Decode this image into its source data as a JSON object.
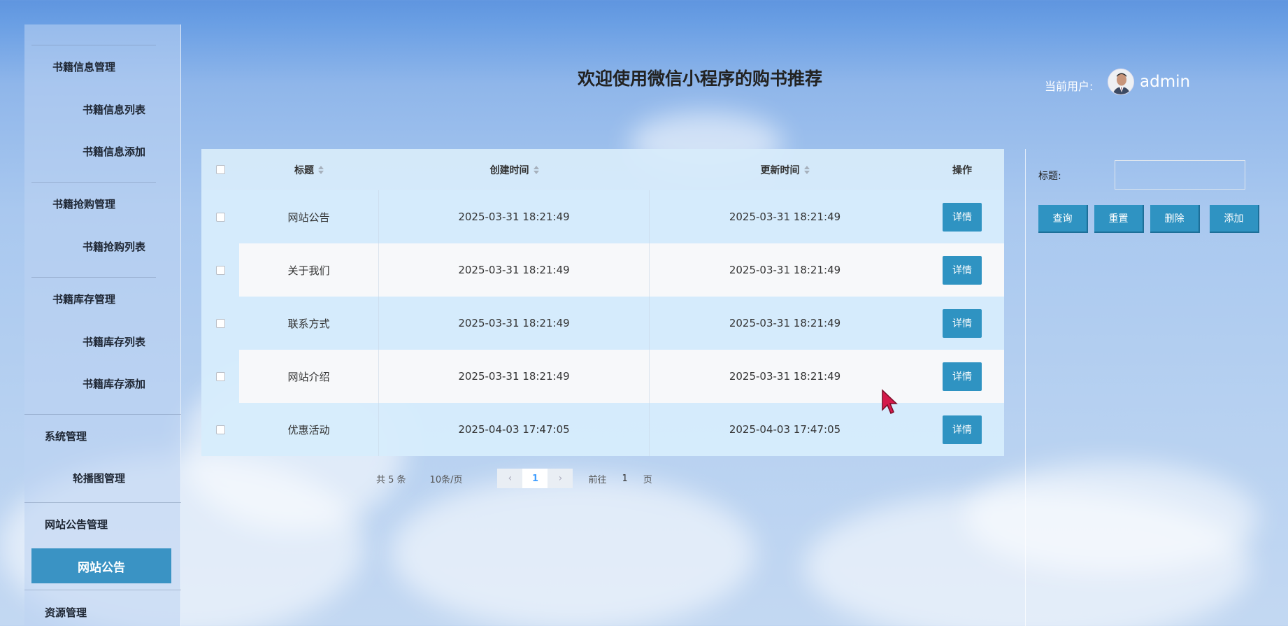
{
  "sidebar": {
    "items": [
      {
        "label": "书籍信息管理"
      },
      {
        "label": "书籍信息列表"
      },
      {
        "label": "书籍信息添加"
      },
      {
        "label": "书籍抢购管理"
      },
      {
        "label": "书籍抢购列表"
      },
      {
        "label": "书籍库存管理"
      },
      {
        "label": "书籍库存列表"
      },
      {
        "label": "书籍库存添加"
      },
      {
        "label": "系统管理"
      },
      {
        "label": "轮播图管理"
      },
      {
        "label": "网站公告管理"
      },
      {
        "label": "网站公告"
      },
      {
        "label": "资源管理"
      }
    ]
  },
  "header": {
    "title": "欢迎使用微信小程序的购书推荐",
    "user_label": "当前用户:",
    "username": "admin"
  },
  "table": {
    "columns": {
      "title": "标题",
      "created": "创建时间",
      "updated": "更新时间",
      "ops": "操作"
    },
    "rows": [
      {
        "title": "网站公告",
        "created": "2025-03-31 18:21:49",
        "updated": "2025-03-31 18:21:49",
        "action": "详情"
      },
      {
        "title": "关于我们",
        "created": "2025-03-31 18:21:49",
        "updated": "2025-03-31 18:21:49",
        "action": "详情"
      },
      {
        "title": "联系方式",
        "created": "2025-03-31 18:21:49",
        "updated": "2025-03-31 18:21:49",
        "action": "详情"
      },
      {
        "title": "网站介绍",
        "created": "2025-03-31 18:21:49",
        "updated": "2025-03-31 18:21:49",
        "action": "详情"
      },
      {
        "title": "优惠活动",
        "created": "2025-04-03 17:47:05",
        "updated": "2025-04-03 17:47:05",
        "action": "详情"
      }
    ]
  },
  "pagination": {
    "total": "共 5 条",
    "page_size": "10条/页",
    "current": "1",
    "goto_label": "前往",
    "goto_value": "1",
    "page_suffix": "页"
  },
  "search": {
    "label": "标题:",
    "value": "",
    "buttons": {
      "query": "查询",
      "reset": "重置",
      "delete": "删除",
      "add": "添加"
    }
  },
  "colors": {
    "accent": "#2f93c2",
    "sidebar_active": "#3a93c4"
  }
}
